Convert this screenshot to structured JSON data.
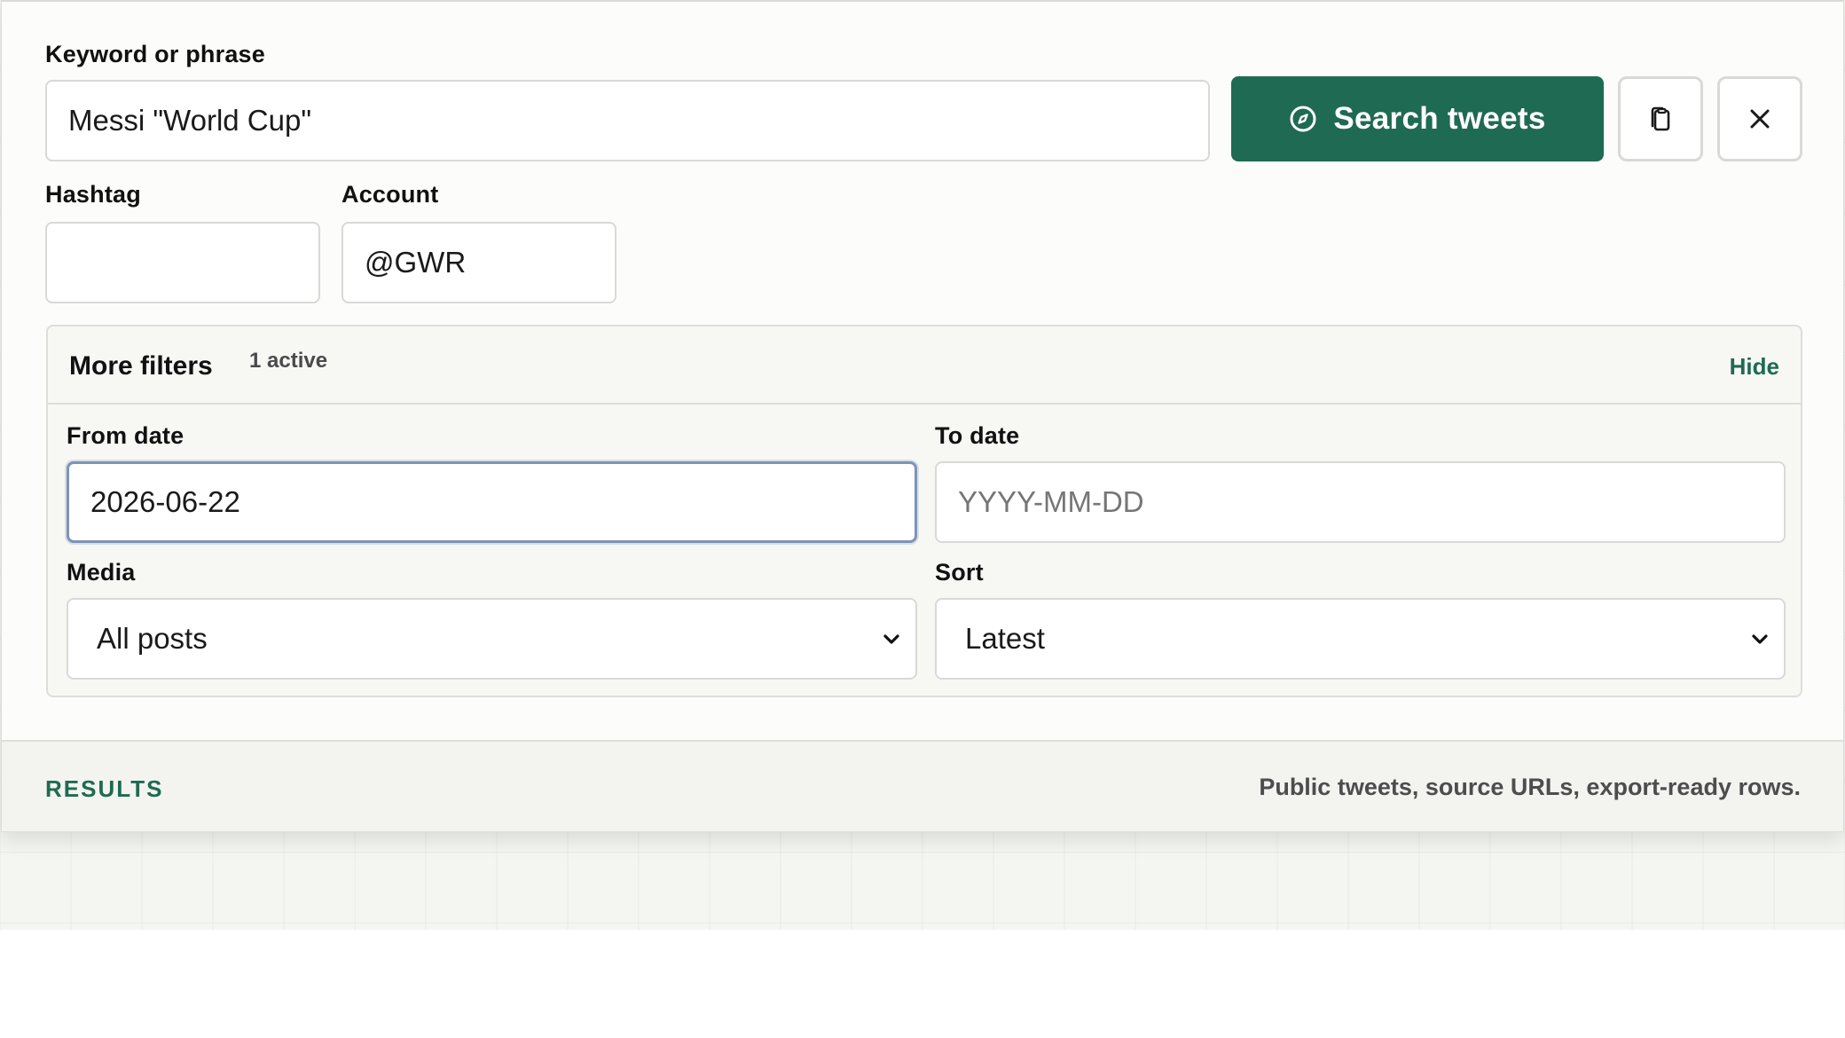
{
  "search": {
    "keyword_label": "Keyword or phrase",
    "keyword_value": "Messi \"World Cup\"",
    "hashtag_label": "Hashtag",
    "hashtag_value": "",
    "account_label": "Account",
    "account_value": "@GWR",
    "search_button_label": "Search tweets",
    "search_button_icon": "compass-icon",
    "copy_button_icon": "copy-icon",
    "clear_button_icon": "close-icon",
    "accent_color": "#1f6a52"
  },
  "filters": {
    "title": "More filters",
    "active_count": "1 active",
    "toggle_label": "Hide",
    "from_date_label": "From date",
    "from_date_value": "2026-06-22",
    "to_date_label": "To date",
    "to_date_placeholder": "YYYY-MM-DD",
    "media_label": "Media",
    "media_selected": "All posts",
    "sort_label": "Sort",
    "sort_selected": "Latest"
  },
  "results": {
    "heading": "RESULTS",
    "description": "Public tweets, source URLs, export-ready rows."
  }
}
